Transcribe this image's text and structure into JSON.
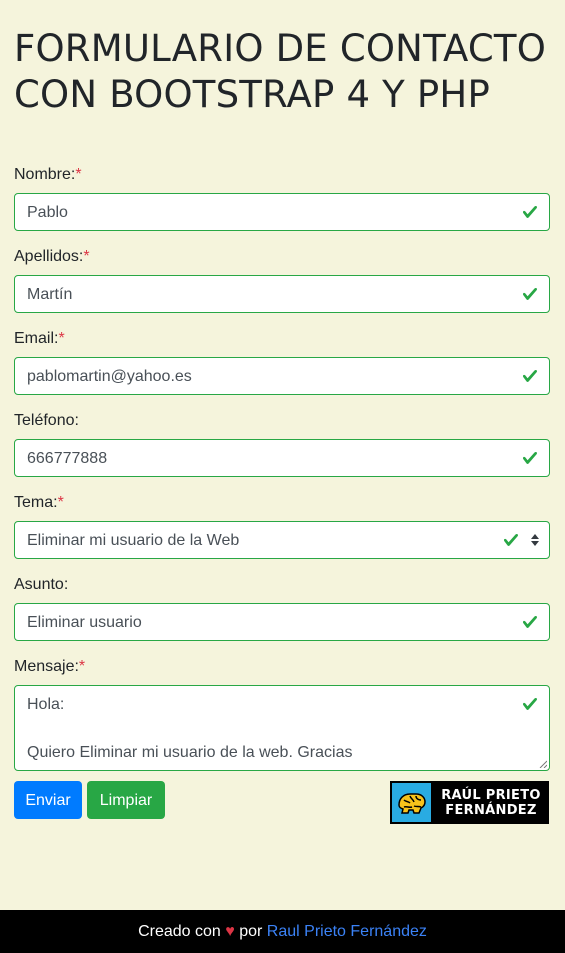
{
  "page": {
    "title": "FORMULARIO DE CONTACTO CON BOOTSTRAP 4 Y PHP"
  },
  "form": {
    "required_marker": "*",
    "nombre": {
      "label": "Nombre:",
      "value": "Pablo",
      "required": true
    },
    "apellidos": {
      "label": "Apellidos:",
      "value": "Martín",
      "required": true
    },
    "email": {
      "label": "Email:",
      "value": "pablomartin@yahoo.es",
      "required": true
    },
    "telefono": {
      "label": "Teléfono:",
      "value": "666777888",
      "required": false
    },
    "tema": {
      "label": "Tema:",
      "value": "Eliminar mi usuario de la Web",
      "required": true
    },
    "asunto": {
      "label": "Asunto:",
      "value": "Eliminar usuario",
      "required": false
    },
    "mensaje": {
      "label": "Mensaje:",
      "line1": "Hola:",
      "line2": "Quiero Eliminar mi usuario de la web. Gracias",
      "required": true
    }
  },
  "buttons": {
    "submit_label": "Enviar",
    "reset_label": "Limpiar"
  },
  "brand": {
    "line1": "RAÚL PRIETO",
    "line2": "FERNÁNDEZ"
  },
  "footer": {
    "prefix": "Creado con",
    "heart": "♥",
    "middle": "por",
    "author_link": "Raul Prieto Fernández"
  },
  "colors": {
    "page_background": "#f5f4dc",
    "valid_border": "#28a745",
    "required_marker": "#dc3545",
    "primary_button": "#007bff",
    "success_button": "#28a745",
    "footer_background": "#000000",
    "footer_link": "#3b82f6"
  },
  "icons": {
    "field_valid": "check-icon",
    "select_arrows": "sort-arrows-icon",
    "brand_logo": "brain-logo-icon",
    "footer_heart": "heart-icon"
  }
}
